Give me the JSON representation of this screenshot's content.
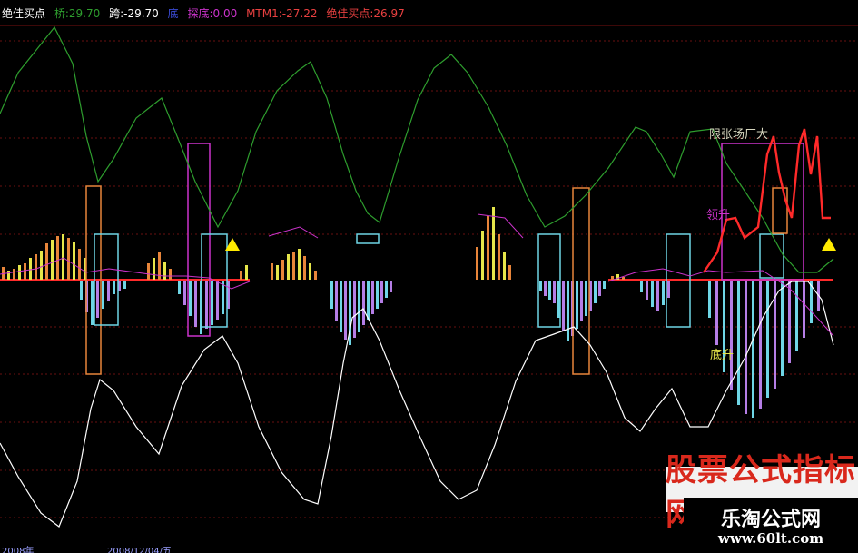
{
  "legend": {
    "title": "绝佳买点",
    "item1": "桥:29.70",
    "item2": "跨:-29.70",
    "item3": "底",
    "item4": "探底:0.00",
    "item5": "MTM1:-27.22",
    "item6": "绝佳买点:26.97"
  },
  "annotations": {
    "top_right": "限张场厂大",
    "rise": "底升",
    "fall": "领升"
  },
  "watermark": {
    "banner": "股票公式指标网",
    "site": "乐淘公式网",
    "url": "www.60lt.com"
  },
  "xaxis": {
    "label1": "2008年",
    "label2": "2008/12/04/五"
  },
  "colors": {
    "green": "#2e9e2e",
    "white": "#ffffff",
    "magenta": "#cc33cc",
    "red": "#ff2a2a",
    "orange": "#e8853a",
    "yellow": "#e6e64a",
    "cyan": "#6fd6e6",
    "violet": "#b57ee6"
  }
}
